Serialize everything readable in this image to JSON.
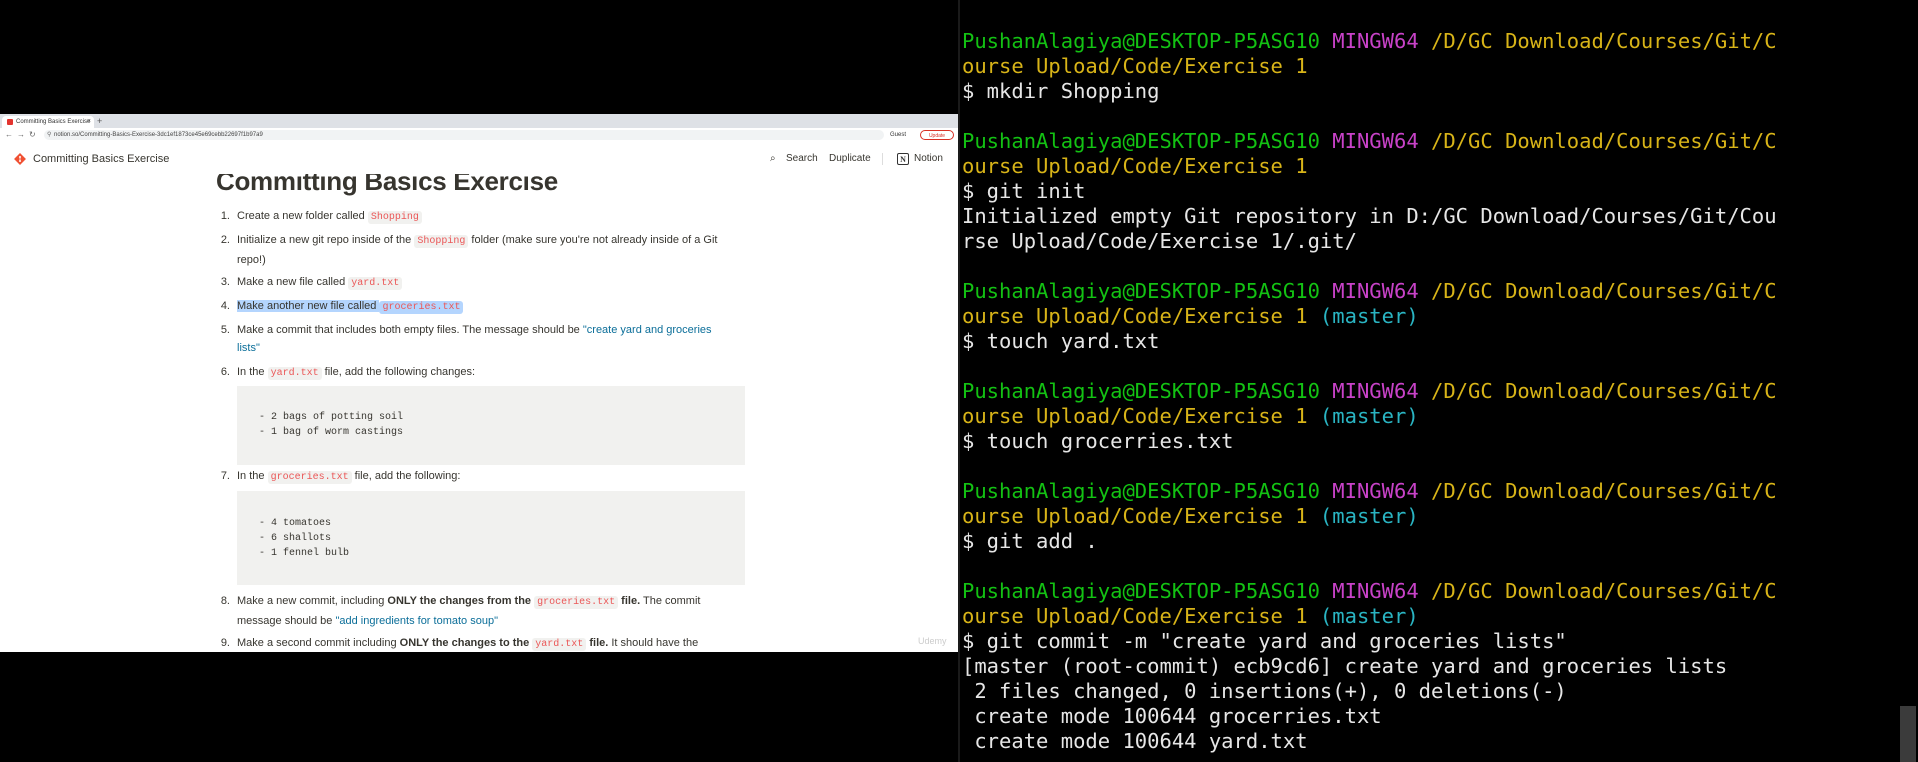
{
  "browser": {
    "tab_title": "Committing Basics Exercise",
    "tab_close": "×",
    "new_tab": "+",
    "url": "notion.so/Committing-Basics-Exercise-3dc1ef1873ce45e69cebb22697f1b97a9",
    "guest_label": "Guest",
    "update_label": "Update"
  },
  "notion": {
    "page_title_crumb": "Committing Basics Exercise",
    "search": "Search",
    "duplicate": "Duplicate",
    "notion": "Notion",
    "heading": "Committing Basics Exercise",
    "steps": [
      {
        "num": "1.",
        "pre": "Create a new folder called ",
        "code": "Shopping",
        "post": ""
      },
      {
        "num": "2.",
        "pre": "Initialize a new git repo inside of the ",
        "code": "Shopping",
        "post": " folder (make sure you're not already inside of a Git repo!)"
      },
      {
        "num": "3.",
        "pre": "Make a new file called ",
        "code": "yard.txt",
        "post": ""
      },
      {
        "num": "4.",
        "pre": "Make another new file called ",
        "code": "groceries.txt",
        "post": ""
      },
      {
        "num": "5.",
        "pre": "Make a commit that includes both empty files.  The message should be ",
        "link": "\"create yard and groceries lists\""
      },
      {
        "num": "6.",
        "pre": "In the ",
        "code": "yard.txt",
        "post": " file, add the following changes:"
      },
      {
        "num": "7.",
        "pre": "In the ",
        "code": "groceries.txt",
        "post": " file, add the following:"
      },
      {
        "num": "8.",
        "pre": "Make a new commit, including ",
        "bold": "ONLY the changes from the ",
        "code": "groceries.txt",
        "bold2": " file.",
        "post": "  The commit message should be ",
        "link": "\"add ingredients for tomato soup\""
      },
      {
        "num": "9.",
        "pre": "Make a second commit including ",
        "bold": "ONLY the changes to the ",
        "code": "yard.txt",
        "bold2": " file.",
        "post": "  It should have the"
      }
    ],
    "yard_block": [
      "- 2 bags of potting soil",
      "- 1 bag of worm castings"
    ],
    "groceries_block": [
      "- 4 tomatoes",
      "- 6 shallots",
      "- 1 fennel bulb"
    ],
    "watermark": "Udemy"
  },
  "terminal": {
    "user": "PushanAlagiya@DESKTOP-P5ASG10",
    "env": "MINGW64",
    "path_line1": "/D/GC Download/Courses/Git/C",
    "path_line2": "ourse Upload/Code/Exercise 1",
    "branch": "(master)",
    "cmd1": "$ mkdir Shopping",
    "cmd2": "$ git init",
    "out2a": "Initialized empty Git repository in D:/GC Download/Courses/Git/Cou",
    "out2b": "rse Upload/Code/Exercise 1/.git/",
    "cmd3": "$ touch yard.txt",
    "cmd4": "$ touch grocerries.txt",
    "cmd5": "$ git add .",
    "cmd6": "$ git commit -m \"create yard and groceries lists\"",
    "out6a": "[master (root-commit) ecb9cd6] create yard and groceries lists",
    "out6b": " 2 files changed, 0 insertions(+), 0 deletions(-)",
    "out6c": " create mode 100644 grocerries.txt",
    "out6d": " create mode 100644 yard.txt"
  },
  "colors": {
    "prompt_user": "#13c213",
    "prompt_env": "#c842c8",
    "prompt_path": "#d8b418",
    "prompt_branch": "#2ab5c3",
    "notion_code": "#eb5757",
    "notion_link": "#0b6e99"
  }
}
